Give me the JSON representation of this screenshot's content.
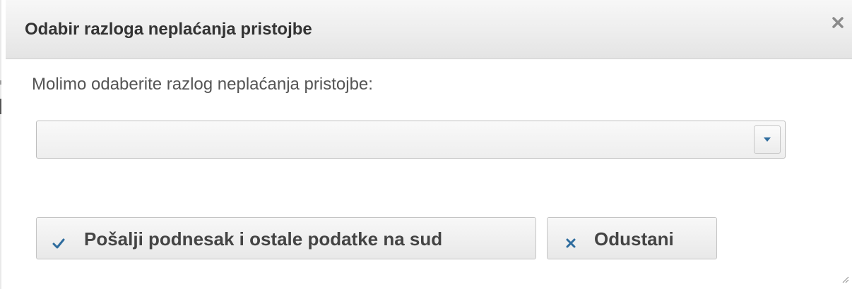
{
  "dialog": {
    "title": "Odabir razloga neplaćanja pristojbe",
    "close_icon": "close-icon",
    "prompt": "Molimo odaberite razlog neplaćanja pristojbe:",
    "reason_select": {
      "selected_value": "",
      "arrow_icon": "caret-down-icon"
    },
    "buttons": {
      "send_label": "Pošalji podnesak i ostale podatke na sud",
      "send_icon": "checkmark-icon",
      "cancel_label": "Odustani",
      "cancel_icon": "x-icon"
    }
  },
  "colors": {
    "icon_accent": "#2e6c9e",
    "title_text": "#333333",
    "body_text": "#555555"
  }
}
